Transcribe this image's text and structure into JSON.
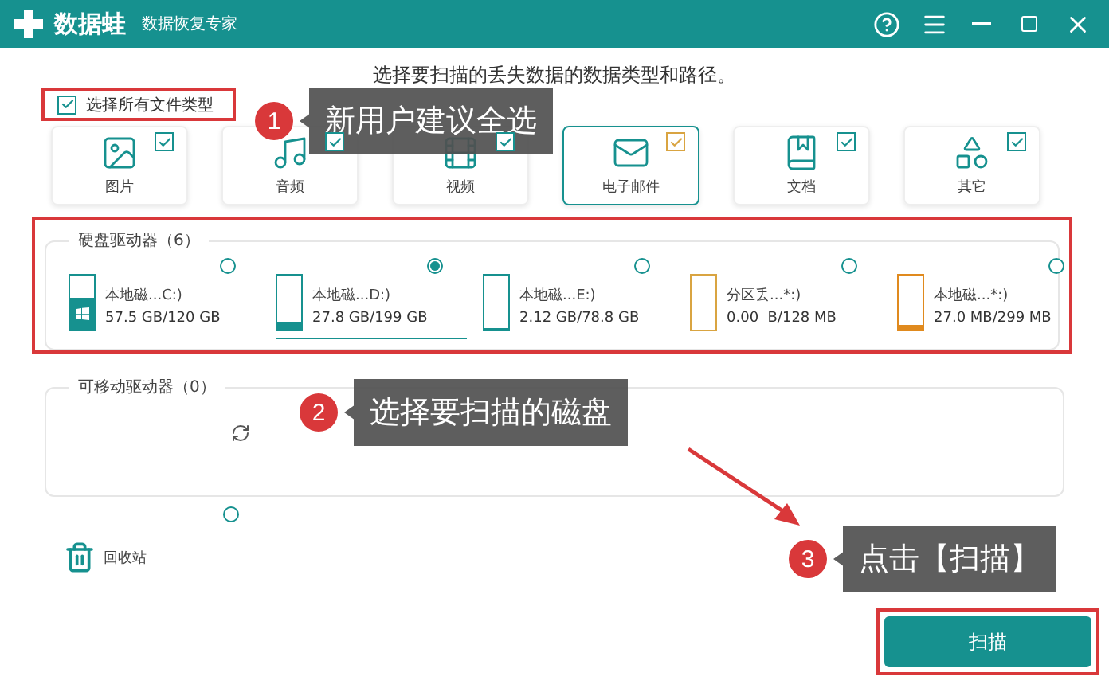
{
  "window": {
    "logo_text": "数据蛙",
    "subtitle": "数据恢复专家"
  },
  "instruction": "选择要扫描的丢失数据的数据类型和路径。",
  "select_all": {
    "label": "选择所有文件类型",
    "checked": true
  },
  "file_types": [
    {
      "kind": "image",
      "label": "图片",
      "checked": true,
      "selected": false
    },
    {
      "kind": "audio",
      "label": "音频",
      "checked": true,
      "selected": false
    },
    {
      "kind": "video",
      "label": "视频",
      "checked": true,
      "selected": false
    },
    {
      "kind": "email",
      "label": "电子邮件",
      "checked": true,
      "selected": true
    },
    {
      "kind": "document",
      "label": "文档",
      "checked": true,
      "selected": false
    },
    {
      "kind": "other",
      "label": "其它",
      "checked": true,
      "selected": false
    }
  ],
  "hard_drives": {
    "title": "硬盘驱动器（6）",
    "drives": [
      {
        "kind": "system",
        "name": "本地磁...C:)",
        "size": "57.5 GB/120 GB",
        "level": 0.6,
        "color": "#16918f",
        "selected": false
      },
      {
        "kind": "disk",
        "name": "本地磁...D:)",
        "size": "27.8 GB/199 GB",
        "level": 0.14,
        "color": "#16918f",
        "selected": true
      },
      {
        "kind": "disk",
        "name": "本地磁...E:)",
        "size": "2.12 GB/78.8 GB",
        "level": 0.03,
        "color": "#16918f",
        "selected": false
      },
      {
        "kind": "disk",
        "name": "分区丢...*:)",
        "size": "0.00  B/128 MB",
        "level": 0,
        "color": "#d9a441",
        "selected": false
      },
      {
        "kind": "disk",
        "name": "本地磁...*:)",
        "size": "27.0 MB/299 MB",
        "level": 0.09,
        "color": "#e08a1e",
        "selected": false
      }
    ]
  },
  "removable": {
    "title": "可移动驱动器（0）"
  },
  "recycle_bin": {
    "label": "回收站",
    "selected": false
  },
  "scan_button": "扫描",
  "annotations": [
    {
      "number": "1",
      "text": "新用户建议全选"
    },
    {
      "number": "2",
      "text": "选择要扫描的磁盘"
    },
    {
      "number": "3",
      "text": "点击【扫描】"
    }
  ]
}
